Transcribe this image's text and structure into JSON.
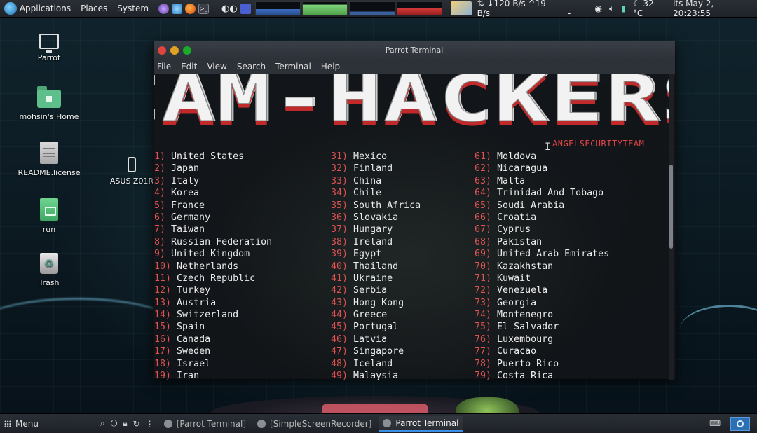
{
  "top_panel": {
    "menus": [
      "Applications",
      "Places",
      "System"
    ],
    "network": {
      "down": "120 B/s",
      "up": "19 B/s"
    },
    "dashes": "--",
    "temperature": "32 °C",
    "datetime": "its May 2, 20:23:55"
  },
  "desktop": {
    "icons": [
      {
        "label": "Parrot",
        "icon": "computer-icon"
      },
      {
        "label": "mohsin's Home",
        "icon": "home-folder-icon"
      },
      {
        "label": "README.license",
        "icon": "text-file-icon"
      },
      {
        "label": "ASUS Z01R",
        "icon": "phone-device-icon"
      },
      {
        "label": "run",
        "icon": "script-file-icon"
      },
      {
        "label": "Trash",
        "icon": "trash-icon"
      }
    ]
  },
  "terminal": {
    "title": "Parrot Terminal",
    "menu": [
      "File",
      "Edit",
      "View",
      "Search",
      "Terminal",
      "Help"
    ],
    "banner": "CAM-HACKERS",
    "team": "ANGELSECURITYTEAM",
    "columns": [
      [
        {
          "num": "1)",
          "name": "United States"
        },
        {
          "num": "2)",
          "name": "Japan"
        },
        {
          "num": "3)",
          "name": "Italy"
        },
        {
          "num": "4)",
          "name": "Korea"
        },
        {
          "num": "5)",
          "name": "France"
        },
        {
          "num": "6)",
          "name": "Germany"
        },
        {
          "num": "7)",
          "name": "Taiwan"
        },
        {
          "num": "8)",
          "name": "Russian Federation"
        },
        {
          "num": "9)",
          "name": "United Kingdom"
        },
        {
          "num": "10)",
          "name": "Netherlands"
        },
        {
          "num": "11)",
          "name": "Czech Republic"
        },
        {
          "num": "12)",
          "name": "Turkey"
        },
        {
          "num": "13)",
          "name": "Austria"
        },
        {
          "num": "14)",
          "name": "Switzerland"
        },
        {
          "num": "15)",
          "name": "Spain"
        },
        {
          "num": "16)",
          "name": "Canada"
        },
        {
          "num": "17)",
          "name": "Sweden"
        },
        {
          "num": "18)",
          "name": "Israel"
        },
        {
          "num": "19)",
          "name": "Iran"
        }
      ],
      [
        {
          "num": "31)",
          "name": "Mexico"
        },
        {
          "num": "32)",
          "name": "Finland"
        },
        {
          "num": "33)",
          "name": "China"
        },
        {
          "num": "34)",
          "name": "Chile"
        },
        {
          "num": "35)",
          "name": "South Africa"
        },
        {
          "num": "36)",
          "name": "Slovakia"
        },
        {
          "num": "37)",
          "name": "Hungary"
        },
        {
          "num": "38)",
          "name": "Ireland"
        },
        {
          "num": "39)",
          "name": "Egypt"
        },
        {
          "num": "40)",
          "name": "Thailand"
        },
        {
          "num": "41)",
          "name": "Ukraine"
        },
        {
          "num": "42)",
          "name": "Serbia"
        },
        {
          "num": "43)",
          "name": "Hong Kong"
        },
        {
          "num": "44)",
          "name": "Greece"
        },
        {
          "num": "45)",
          "name": "Portugal"
        },
        {
          "num": "46)",
          "name": "Latvia"
        },
        {
          "num": "47)",
          "name": "Singapore"
        },
        {
          "num": "48)",
          "name": "Iceland"
        },
        {
          "num": "49)",
          "name": "Malaysia"
        }
      ],
      [
        {
          "num": "61)",
          "name": "Moldova"
        },
        {
          "num": "62)",
          "name": "Nicaragua"
        },
        {
          "num": "63)",
          "name": "Malta"
        },
        {
          "num": "64)",
          "name": "Trinidad And Tobago"
        },
        {
          "num": "65)",
          "name": "Soudi Arabia"
        },
        {
          "num": "66)",
          "name": "Croatia"
        },
        {
          "num": "67)",
          "name": "Cyprus"
        },
        {
          "num": "68)",
          "name": "Pakistan"
        },
        {
          "num": "69)",
          "name": "United Arab Emirates"
        },
        {
          "num": "70)",
          "name": "Kazakhstan"
        },
        {
          "num": "71)",
          "name": "Kuwait"
        },
        {
          "num": "72)",
          "name": "Venezuela"
        },
        {
          "num": "73)",
          "name": "Georgia"
        },
        {
          "num": "74)",
          "name": "Montenegro"
        },
        {
          "num": "75)",
          "name": "El Salvador"
        },
        {
          "num": "76)",
          "name": "Luxembourg"
        },
        {
          "num": "77)",
          "name": "Curacao"
        },
        {
          "num": "78)",
          "name": "Puerto Rico"
        },
        {
          "num": "79)",
          "name": "Costa Rica"
        }
      ]
    ]
  },
  "bottom_panel": {
    "menu_label": "Menu",
    "tasks": [
      {
        "label": "[Parrot Terminal]",
        "active": false
      },
      {
        "label": "[SimpleScreenRecorder]",
        "active": false
      },
      {
        "label": "Parrot Terminal",
        "active": true
      }
    ]
  },
  "colors": {
    "number_red": "#e05252",
    "team_red": "#e04444",
    "banner_white": "#f2f2f2",
    "banner_shadow": "#c02a2a",
    "panel_bg": "#2a2f36",
    "active_task_accent": "#3a8ee6"
  }
}
